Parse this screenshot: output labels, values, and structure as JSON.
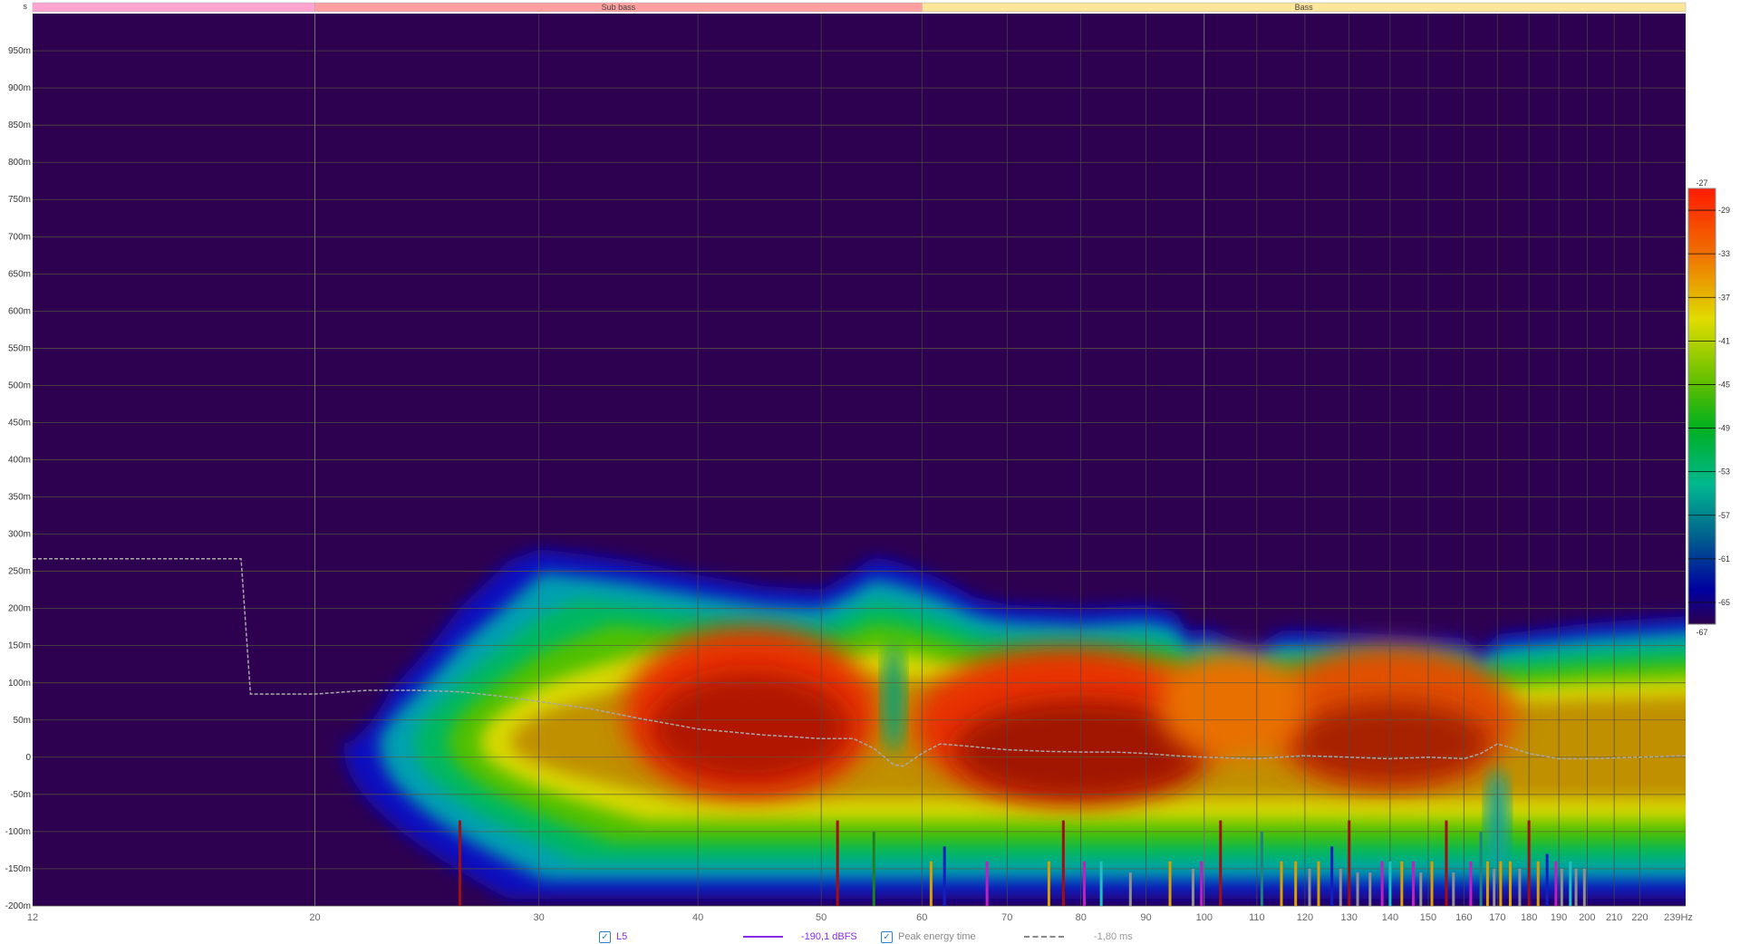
{
  "bands": {
    "unit_label": "s",
    "items": [
      {
        "label": "",
        "from": 12,
        "to": 20,
        "color": "#ffa3d1"
      },
      {
        "label": "Sub bass",
        "from": 20,
        "to": 60,
        "color": "#ff9f9f"
      },
      {
        "label": "Bass",
        "from": 60,
        "to": 239,
        "color": "#fde59a"
      }
    ]
  },
  "chart_data": {
    "type": "heatmap",
    "title": "Spectrogram",
    "xlabel": "Hz",
    "ylabel": "s",
    "xscale": "log",
    "xlim": [
      12,
      239
    ],
    "ylim": [
      -200,
      1000
    ],
    "x_ticks": [
      "12",
      "20",
      "30",
      "40",
      "50",
      "60",
      "70",
      "80",
      "90",
      "100",
      "110",
      "120",
      "130",
      "140",
      "150",
      "160",
      "170",
      "180",
      "190",
      "200",
      "210",
      "220",
      "239Hz"
    ],
    "x_tick_values": [
      12,
      20,
      30,
      40,
      50,
      60,
      70,
      80,
      90,
      100,
      110,
      120,
      130,
      140,
      150,
      160,
      170,
      180,
      190,
      200,
      210,
      220,
      239
    ],
    "y_ticks": [
      "950m",
      "900m",
      "850m",
      "800m",
      "750m",
      "700m",
      "650m",
      "600m",
      "550m",
      "500m",
      "450m",
      "400m",
      "350m",
      "300m",
      "250m",
      "200m",
      "150m",
      "100m",
      "50m",
      "0",
      "-50m",
      "-100m",
      "-150m",
      "-200m"
    ],
    "y_tick_values": [
      950,
      900,
      850,
      800,
      750,
      700,
      650,
      600,
      550,
      500,
      450,
      400,
      350,
      300,
      250,
      200,
      150,
      100,
      50,
      0,
      -50,
      -100,
      -150,
      -200
    ],
    "background_color": "#2d0050",
    "colorbar": {
      "min_label": "-67",
      "max_label": "-27",
      "ticks": [
        "-29",
        "-33",
        "-37",
        "-41",
        "-45",
        "-49",
        "-53",
        "-57",
        "-61",
        "-65"
      ],
      "tick_values": [
        -29,
        -33,
        -37,
        -41,
        -45,
        -49,
        -53,
        -57,
        -61,
        -65
      ],
      "range": [
        -67,
        -27
      ]
    },
    "envelope_top_ms": {
      "freq": [
        21,
        23,
        26,
        30,
        35,
        40,
        45,
        50,
        53,
        55,
        58,
        62,
        66,
        70,
        80,
        90,
        95,
        97,
        100,
        105,
        110,
        115,
        120,
        140,
        160,
        165,
        170,
        200,
        239
      ],
      "ms": [
        0,
        160,
        240,
        280,
        265,
        245,
        230,
        225,
        250,
        270,
        260,
        240,
        215,
        205,
        200,
        205,
        195,
        165,
        175,
        160,
        150,
        170,
        170,
        165,
        160,
        140,
        165,
        180,
        190
      ]
    },
    "envelope_bottom_ms": -190,
    "peak_energy_time": {
      "name": "Peak energy time",
      "freq": [
        12,
        17.5,
        17.8,
        20,
        22,
        24,
        26,
        28,
        30,
        33,
        36,
        40,
        45,
        50,
        53,
        55,
        57,
        58,
        60,
        62,
        65,
        70,
        75,
        80,
        85,
        90,
        95,
        100,
        110,
        120,
        130,
        140,
        150,
        160,
        165,
        170,
        175,
        180,
        190,
        200,
        220,
        239
      ],
      "ms": [
        267,
        267,
        85,
        85,
        90,
        90,
        88,
        82,
        75,
        65,
        52,
        38,
        30,
        25,
        25,
        12,
        -10,
        -12,
        5,
        18,
        15,
        10,
        8,
        7,
        7,
        5,
        2,
        0,
        -2,
        2,
        0,
        -2,
        0,
        -2,
        5,
        18,
        12,
        5,
        -2,
        -2,
        0,
        2
      ]
    },
    "markers": [
      {
        "f": 26,
        "c": "#a01010",
        "ms": -85
      },
      {
        "f": 51.5,
        "c": "#a01010",
        "ms": -85
      },
      {
        "f": 55,
        "c": "#208020",
        "ms": -100
      },
      {
        "f": 61,
        "c": "#d9a000",
        "ms": -140
      },
      {
        "f": 62.5,
        "c": "#1020c0",
        "ms": -120
      },
      {
        "f": 67.5,
        "c": "#c020c0",
        "ms": -140
      },
      {
        "f": 75.5,
        "c": "#d9a000",
        "ms": -140
      },
      {
        "f": 77.5,
        "c": "#a01010",
        "ms": -85
      },
      {
        "f": 80.5,
        "c": "#c020c0",
        "ms": -140
      },
      {
        "f": 83,
        "c": "#20c0c0",
        "ms": -140
      },
      {
        "f": 87.5,
        "c": "#909090",
        "ms": -155
      },
      {
        "f": 94,
        "c": "#d9a000",
        "ms": -140
      },
      {
        "f": 98,
        "c": "#909090",
        "ms": -150
      },
      {
        "f": 99.5,
        "c": "#c020c0",
        "ms": -140
      },
      {
        "f": 103,
        "c": "#a01010",
        "ms": -85
      },
      {
        "f": 111,
        "c": "#208080",
        "ms": -100
      },
      {
        "f": 115,
        "c": "#d9a000",
        "ms": -140
      },
      {
        "f": 118,
        "c": "#d9a000",
        "ms": -140
      },
      {
        "f": 121,
        "c": "#909090",
        "ms": -150
      },
      {
        "f": 123,
        "c": "#d9a000",
        "ms": -140
      },
      {
        "f": 126,
        "c": "#1020c0",
        "ms": -120
      },
      {
        "f": 128,
        "c": "#909090",
        "ms": -150
      },
      {
        "f": 130,
        "c": "#a01010",
        "ms": -85
      },
      {
        "f": 132,
        "c": "#909090",
        "ms": -155
      },
      {
        "f": 135,
        "c": "#909090",
        "ms": -155
      },
      {
        "f": 138,
        "c": "#c020c0",
        "ms": -140
      },
      {
        "f": 140,
        "c": "#20c0c0",
        "ms": -140
      },
      {
        "f": 143,
        "c": "#d9a000",
        "ms": -140
      },
      {
        "f": 146,
        "c": "#c020c0",
        "ms": -140
      },
      {
        "f": 148,
        "c": "#909090",
        "ms": -155
      },
      {
        "f": 151,
        "c": "#d9a000",
        "ms": -140
      },
      {
        "f": 155,
        "c": "#a01010",
        "ms": -85
      },
      {
        "f": 157,
        "c": "#909090",
        "ms": -155
      },
      {
        "f": 162,
        "c": "#c020c0",
        "ms": -140
      },
      {
        "f": 165,
        "c": "#208080",
        "ms": -100
      },
      {
        "f": 167,
        "c": "#d9a000",
        "ms": -140
      },
      {
        "f": 169,
        "c": "#909090",
        "ms": -150
      },
      {
        "f": 171,
        "c": "#d9a000",
        "ms": -140
      },
      {
        "f": 174,
        "c": "#d9a000",
        "ms": -140
      },
      {
        "f": 177,
        "c": "#909090",
        "ms": -150
      },
      {
        "f": 180,
        "c": "#a01010",
        "ms": -85
      },
      {
        "f": 183,
        "c": "#d9a000",
        "ms": -140
      },
      {
        "f": 186,
        "c": "#1020c0",
        "ms": -130
      },
      {
        "f": 189,
        "c": "#c020c0",
        "ms": -140
      },
      {
        "f": 191,
        "c": "#909090",
        "ms": -150
      },
      {
        "f": 194,
        "c": "#20c0c0",
        "ms": -140
      },
      {
        "f": 196,
        "c": "#909090",
        "ms": -150
      },
      {
        "f": 199,
        "c": "#909090",
        "ms": -150
      }
    ]
  },
  "legend": {
    "series_checkbox": "L5",
    "series_value": "-190,1 dBFS",
    "series_color": "#8a2be2",
    "overlay_checkbox": "Peak energy time",
    "overlay_value": "-1,80 ms"
  }
}
